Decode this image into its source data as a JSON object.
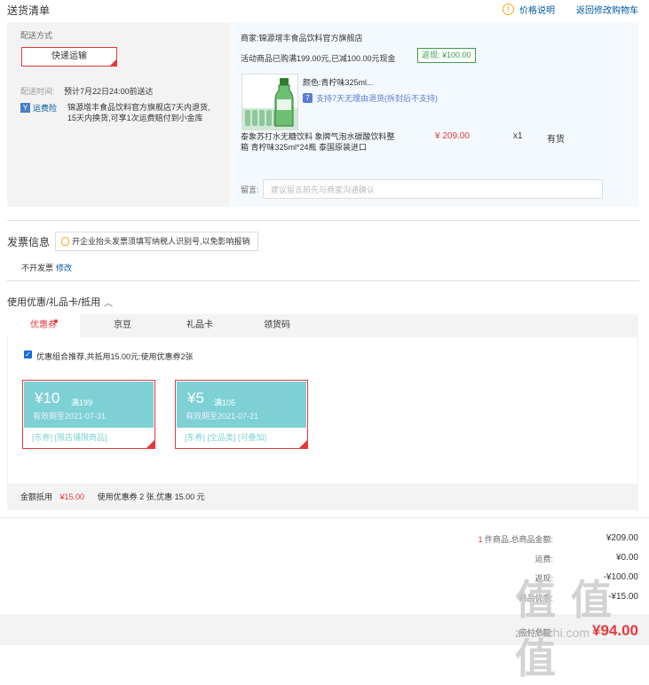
{
  "header": {
    "title": "送货清单",
    "price_note": "价格说明",
    "back_to_cart": "返回修改购物车"
  },
  "delivery": {
    "method_label": "配送方式",
    "method_button": "快递运输",
    "time_label": "配送时间:",
    "time_value": "预计7月22日24:00前送达",
    "insurance_icon": "insurance-icon",
    "insurance_label": "运费险",
    "insurance_desc_line1": "锦源增丰食品饮料官方旗舰店7天内退货,",
    "insurance_desc_line2": "15天内换货,可享1次运费赔付到小金库"
  },
  "shop": {
    "merchant": "商家:锦源增丰食品饮料官方旗舰店",
    "promo": "活动商品已购满199.00元,已减100.00元现金",
    "cashback": "返现: ¥100.00"
  },
  "product": {
    "color": "颜色:青柠味325ml...",
    "support": "支持7天无理由退货(拆封后不支持)",
    "name_line1": "泰象苏打水无糖饮料 象牌气泡水碳酸饮料整",
    "name_line2": "箱 青柠味325ml*24瓶 泰国原装进口",
    "price": "¥ 209.00",
    "qty": "x1",
    "stock": "有货"
  },
  "remark": {
    "label": "留言:",
    "placeholder": "建议留言前先与商家沟通确认"
  },
  "invoice": {
    "title": "发票信息",
    "tip": "开企业抬头发票须填写纳税人识别号,以免影响报销",
    "status": "不开发票",
    "edit": "修改"
  },
  "coupons": {
    "section_title": "使用优惠/礼品卡/抵用",
    "tabs": [
      "优惠券",
      "京豆",
      "礼品卡",
      "领货码"
    ],
    "recommend": "优惠组合推荐,共抵用15.00元:使用优惠券2张",
    "items": [
      {
        "amount": "¥10",
        "condition": "满199",
        "expiry": "有效期至2021-07-31",
        "tags": "[东券] [限店铺限商品]"
      },
      {
        "amount": "¥5",
        "condition": "满105",
        "expiry": "有效期至2021-07-21",
        "tags": "[东券] [全品类] [可叠加]"
      }
    ],
    "discount_label": "金额抵用",
    "discount_value": "¥15.00",
    "discount_desc": "使用优惠券 2 张,优惠 15.00 元"
  },
  "totals": {
    "count": "1",
    "count_suffix": "件商品,总商品金额:",
    "goods_amount": "¥209.00",
    "shipping_label": "运费:",
    "shipping": "¥0.00",
    "cashback_label": "返现:",
    "cashback": "-¥100.00",
    "coupon_label": "商品优惠:",
    "coupon": "-¥15.00",
    "payable_label": "应付总额:",
    "payable": "¥94.00"
  },
  "watermark": {
    "logo": "值 值 值",
    "text": "zhizhizhi.com"
  },
  "colors": {
    "accent_red": "#e4393c",
    "link_blue": "#005aa0",
    "coupon_teal": "#7dd1d4",
    "cash_green": "#3b9f4c"
  }
}
